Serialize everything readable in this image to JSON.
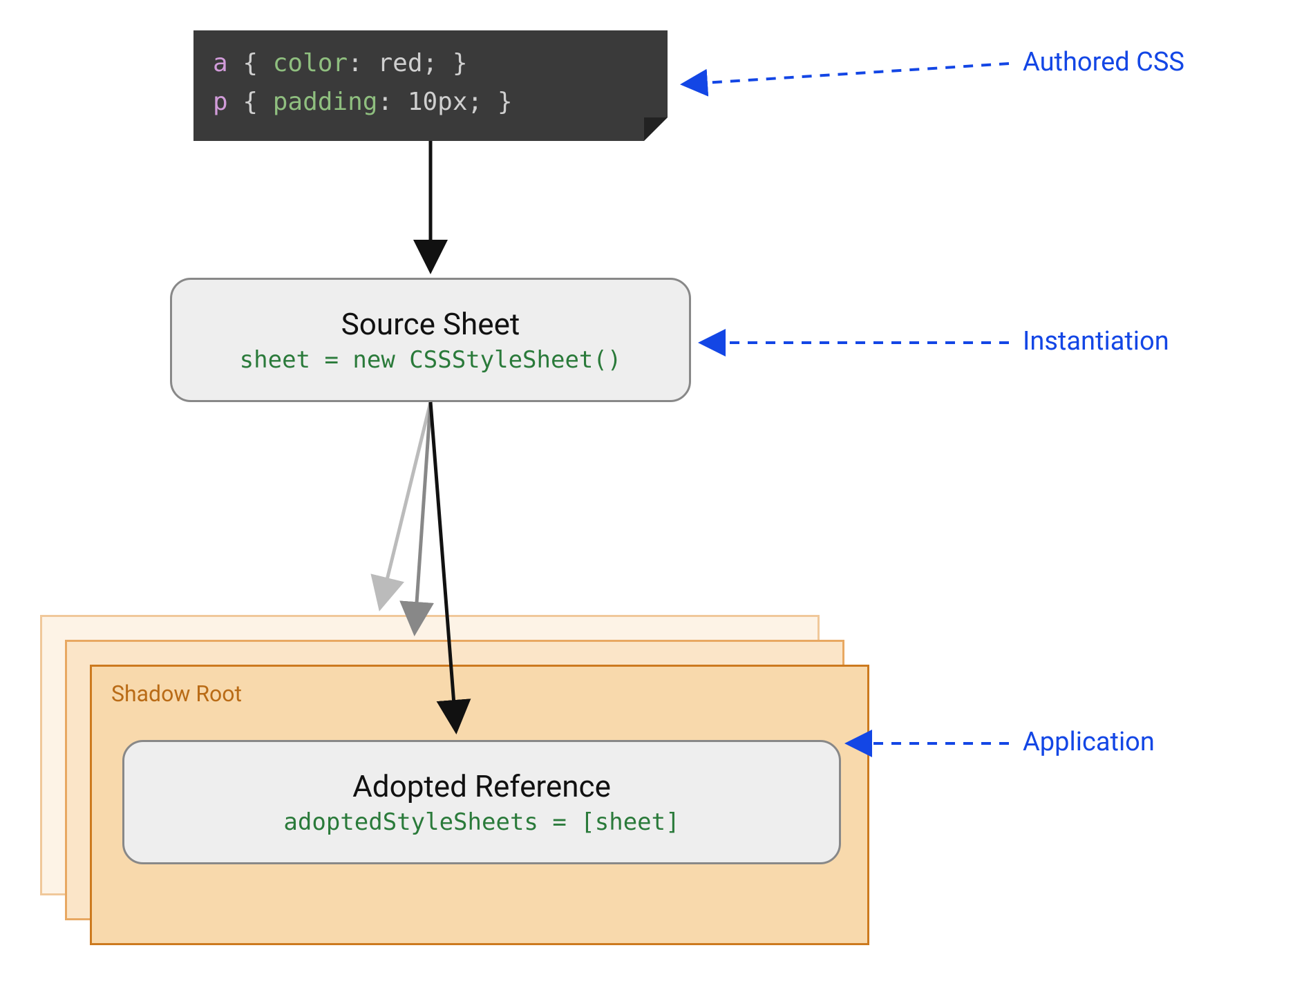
{
  "code": {
    "line1": {
      "sel": "a",
      "prop": "color",
      "val": "red"
    },
    "line2": {
      "sel": "p",
      "prop": "padding",
      "val": "10px"
    }
  },
  "source": {
    "title": "Source Sheet",
    "code": "sheet = new CSSStyleSheet()"
  },
  "shadow": {
    "label": "Shadow Root"
  },
  "adopted": {
    "title": "Adopted Reference",
    "code": "adoptedStyleSheets = [sheet]"
  },
  "annotations": {
    "authored": "Authored CSS",
    "instantiation": "Instantiation",
    "application": "Application"
  },
  "colors": {
    "annotation": "#1346e5",
    "shadowBorder": "#cc7a1f",
    "shadowFill": "#f8d9ac",
    "codeBg": "#3a3a3a"
  }
}
